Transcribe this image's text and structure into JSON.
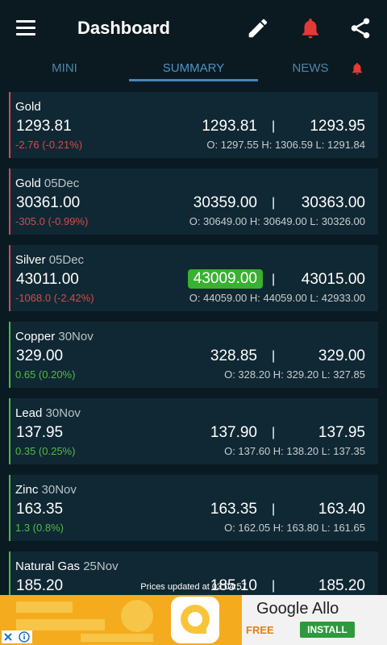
{
  "header": {
    "title": "Dashboard"
  },
  "tabs": [
    {
      "label": "MINI"
    },
    {
      "label": "SUMMARY"
    },
    {
      "label": "NEWS"
    }
  ],
  "active_tab": "SUMMARY",
  "colors": {
    "background": "#0a1a22",
    "card": "#102833",
    "negative": "#d64a4a",
    "positive": "#4fb843",
    "accent_tab": "#4e93c1",
    "highlight": "#39b031",
    "bell": "#e53935"
  },
  "quotes": [
    {
      "name": "Gold",
      "expiry": "",
      "ltp": "1293.81",
      "change": "-2.76 (-0.21%)",
      "bid": "1293.81",
      "ask": "1293.95",
      "ohl": "O: 1297.55  H: 1306.59  L: 1291.84",
      "direction": "neg",
      "highlight": false
    },
    {
      "name": "Gold",
      "expiry": "05Dec",
      "ltp": "30361.00",
      "change": "-305.0 (-0.99%)",
      "bid": "30359.00",
      "ask": "30363.00",
      "ohl": "O: 30649.00  H: 30649.00  L: 30326.00",
      "direction": "neg",
      "highlight": false
    },
    {
      "name": "Silver",
      "expiry": "05Dec",
      "ltp": "43011.00",
      "change": "-1068.0 (-2.42%)",
      "bid": "43009.00",
      "ask": "43015.00",
      "ohl": "O: 44059.00  H: 44059.00  L: 42933.00",
      "direction": "neg",
      "highlight": true
    },
    {
      "name": "Copper",
      "expiry": "30Nov",
      "ltp": "329.00",
      "change": "0.65 (0.20%)",
      "bid": "328.85",
      "ask": "329.00",
      "ohl": "O: 328.20  H: 329.20  L: 327.85",
      "direction": "pos",
      "highlight": false
    },
    {
      "name": "Lead",
      "expiry": "30Nov",
      "ltp": "137.95",
      "change": "0.35 (0.25%)",
      "bid": "137.90",
      "ask": "137.95",
      "ohl": "O: 137.60  H: 138.20  L: 137.35",
      "direction": "pos",
      "highlight": false
    },
    {
      "name": "Zinc",
      "expiry": "30Nov",
      "ltp": "163.35",
      "change": "1.3 (0.8%)",
      "bid": "163.35",
      "ask": "163.40",
      "ohl": "O: 162.05  H: 163.80  L: 161.65",
      "direction": "pos",
      "highlight": false
    },
    {
      "name": "Natural Gas",
      "expiry": "25Nov",
      "ltp": "185.20",
      "change": "",
      "bid": "185.10",
      "ask": "185.20",
      "ohl": "",
      "direction": "pos",
      "highlight": false
    }
  ],
  "status": {
    "text": "Prices updated at 03:04:57"
  },
  "ad": {
    "app_name": "Google Allo",
    "price": "FREE",
    "install_label": "INSTALL"
  },
  "icons": [
    "menu-icon",
    "pencil-icon",
    "bell-icon",
    "share-icon",
    "tab-bell-icon",
    "ad-info-icon",
    "ad-close-icon"
  ]
}
